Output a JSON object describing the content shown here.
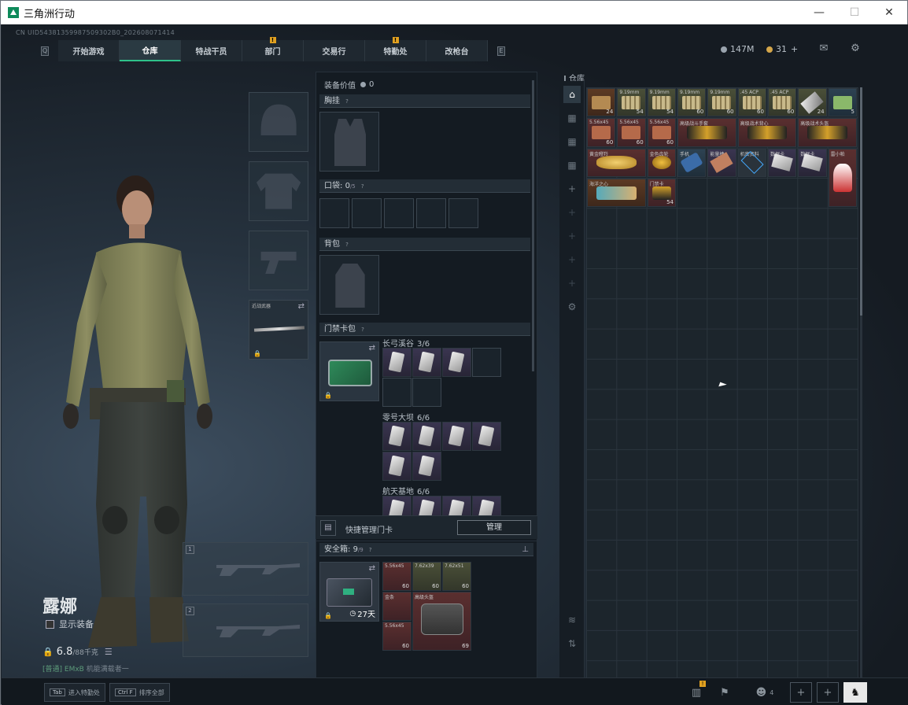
{
  "window": {
    "title": "三角洲行动",
    "min": "—",
    "max": "☐",
    "close": "✕"
  },
  "uid": "CN UID54381359987509302B0_202608071414",
  "nav": {
    "left_key": "Q",
    "right_key": "E",
    "tabs": [
      {
        "label": "开始游戏",
        "active": false,
        "alert": false
      },
      {
        "label": "仓库",
        "active": true,
        "alert": false
      },
      {
        "label": "特战干员",
        "active": false,
        "alert": false
      },
      {
        "label": "部门",
        "active": false,
        "alert": true
      },
      {
        "label": "交易行",
        "active": false,
        "alert": false
      },
      {
        "label": "特勤处",
        "active": false,
        "alert": true
      },
      {
        "label": "改枪台",
        "active": false,
        "alert": false
      }
    ],
    "alert_mark": "!"
  },
  "resources": {
    "currency": "147M",
    "coins": "31",
    "coins_add": "+"
  },
  "character": {
    "name": "露娜",
    "show_equipment": "显示装备",
    "weight_value": "6.8",
    "weight_max": "/88千克",
    "status_tag": "[普通]",
    "status_cap": "EMxB",
    "status_text": "机能满载者一"
  },
  "weapon_slots": [
    {
      "num": "1"
    },
    {
      "num": "2"
    }
  ],
  "equipment": {
    "value_label": "装备价值",
    "value": "0",
    "chest_rig": "胸挂",
    "pockets_label": "口袋:",
    "pockets_count": "0",
    "pockets_max": "/5",
    "backpack": "背包",
    "keycard_pack": "门禁卡包",
    "help": "?",
    "side_slot_label": "近战武器",
    "keycards": [
      {
        "map": "长弓溪谷",
        "count": "3/6"
      },
      {
        "map": "零号大坝",
        "count": "6/6"
      },
      {
        "map": "航天基地",
        "count": "6/6"
      }
    ],
    "quick_manage": "快捷管理门卡",
    "manage_btn": "管理",
    "safe_box": "安全箱:",
    "safe_count": "9",
    "safe_max": "/9",
    "safe_time": "27天"
  },
  "safe_items": [
    {
      "label": "5.56x45",
      "count": "60"
    },
    {
      "label": "7.62x39",
      "count": "60"
    },
    {
      "label": "7.62x51",
      "count": "60"
    },
    {
      "label": "金条",
      "count": ""
    },
    {
      "label": "高级头盔",
      "count": ""
    },
    {
      "label": "5.56x45",
      "count": "60"
    },
    {
      "label": "",
      "count": "69"
    }
  ],
  "warehouse": {
    "label": "仓库",
    "row1": [
      {
        "label": "",
        "count": "24"
      },
      {
        "label": "9.19mm",
        "count": "54"
      },
      {
        "label": "9.19mm",
        "count": "54"
      },
      {
        "label": "9.19mm",
        "count": "60"
      },
      {
        "label": "9.19mm",
        "count": "60"
      },
      {
        "label": ".45 ACP",
        "count": "60"
      },
      {
        "label": ".45 ACP",
        "count": "60"
      },
      {
        "label": "",
        "count": "24"
      },
      {
        "label": "",
        "count": "5"
      }
    ],
    "row2": [
      {
        "label": "5.56x45",
        "count": "60"
      },
      {
        "label": "5.56x45",
        "count": "60"
      },
      {
        "label": "5.56x45",
        "count": "60"
      },
      {
        "label": "高级战斗手套",
        "count": ""
      },
      {
        "label": "高级战术背心",
        "count": ""
      },
      {
        "label": "高级战术头盔",
        "count": ""
      }
    ],
    "row3": [
      {
        "label": "黄金瞪羚",
        "count": ""
      },
      {
        "label": "金色齿轮",
        "count": ""
      },
      {
        "label": "手机",
        "count": ""
      },
      {
        "label": "能量棒",
        "count": ""
      },
      {
        "label": "机密资料",
        "count": ""
      },
      {
        "label": "数据卡",
        "count": ""
      },
      {
        "label": "数据卡",
        "count": ""
      },
      {
        "label": "雷小帕",
        "count": ""
      }
    ],
    "row4": [
      {
        "label": "海洋之心",
        "count": ""
      },
      {
        "label": "门禁卡",
        "count": "54"
      }
    ]
  },
  "bottom": {
    "left_keys": [
      {
        "key": "Tab",
        "label": "进入特勤处"
      },
      {
        "key": "Ctrl F",
        "label": "排序全部"
      }
    ],
    "friends": "4"
  }
}
